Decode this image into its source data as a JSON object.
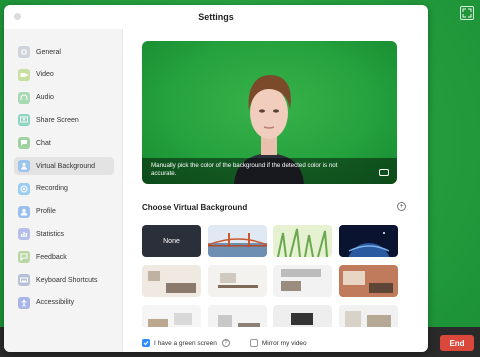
{
  "window": {
    "title": "Settings"
  },
  "sidebar": {
    "items": [
      {
        "label": "General",
        "icon": "gear-icon",
        "color": "#cfd3da",
        "active": false
      },
      {
        "label": "Video",
        "icon": "video-icon",
        "color": "#c7df9f",
        "active": false
      },
      {
        "label": "Audio",
        "icon": "headphones-icon",
        "color": "#a8d9b0",
        "active": false
      },
      {
        "label": "Share Screen",
        "icon": "share-screen-icon",
        "color": "#8fd6c0",
        "active": false
      },
      {
        "label": "Chat",
        "icon": "chat-icon",
        "color": "#9fd2a0",
        "active": false
      },
      {
        "label": "Virtual Background",
        "icon": "person-icon",
        "color": "#9dc4ec",
        "active": true
      },
      {
        "label": "Recording",
        "icon": "record-icon",
        "color": "#9ccdf0",
        "active": false
      },
      {
        "label": "Profile",
        "icon": "profile-icon",
        "color": "#9ac0f0",
        "active": false
      },
      {
        "label": "Statistics",
        "icon": "statistics-icon",
        "color": "#b6bfe8",
        "active": false
      },
      {
        "label": "Feedback",
        "icon": "feedback-icon",
        "color": "#b8d7a4",
        "active": false
      },
      {
        "label": "Keyboard Shortcuts",
        "icon": "keyboard-icon",
        "color": "#b7c0d6",
        "active": false
      },
      {
        "label": "Accessibility",
        "icon": "accessibility-icon",
        "color": "#a9b5e6",
        "active": false
      }
    ]
  },
  "preview": {
    "hint": "Manually pick the color of the background if the detected color is not accurate."
  },
  "backgrounds": {
    "title": "Choose Virtual Background",
    "none_label": "None",
    "items": [
      {
        "name": "none"
      },
      {
        "name": "golden-gate"
      },
      {
        "name": "grass"
      },
      {
        "name": "earth"
      },
      {
        "name": "room-1"
      },
      {
        "name": "room-2"
      },
      {
        "name": "room-3"
      },
      {
        "name": "room-4"
      },
      {
        "name": "room-5"
      },
      {
        "name": "room-6"
      },
      {
        "name": "room-7"
      },
      {
        "name": "room-8"
      }
    ]
  },
  "footer": {
    "green_screen_label": "I have a green screen",
    "green_screen_checked": true,
    "mirror_label": "Mirror my video",
    "mirror_checked": false
  },
  "meeting": {
    "end_label": "End"
  },
  "colors": {
    "accent": "#2d8cff",
    "end": "#d9483b",
    "green_screen": "#27a140"
  }
}
